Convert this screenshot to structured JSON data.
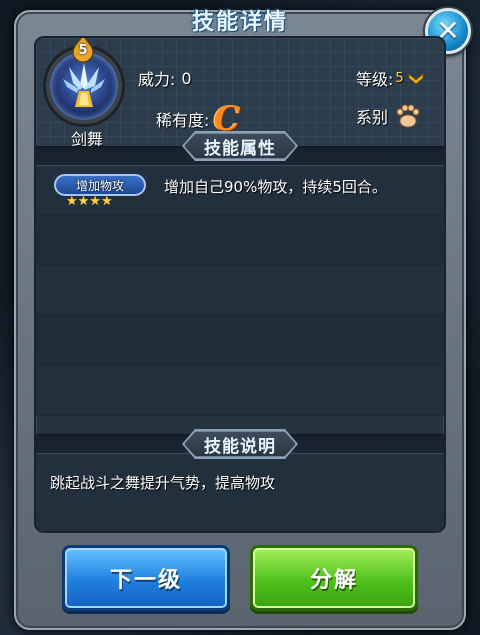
{
  "window": {
    "title": "技能详情",
    "close_symbol": "✕"
  },
  "skill": {
    "name": "剑舞",
    "level_badge": "5",
    "power_label": "威力:",
    "power_value": "0",
    "grade_label": "等级:",
    "grade_value": "5",
    "rarity_label": "稀有度:",
    "rarity_value": "C",
    "series_label": "系别",
    "series_icon": "paw-icon"
  },
  "sections": {
    "attributes_title": "技能属性",
    "description_title": "技能说明"
  },
  "attributes": [
    {
      "badge": "增加物攻",
      "stars": "★★★★",
      "star_count": 4,
      "desc": "增加自己90%物攻，持续5回合。"
    }
  ],
  "description": "跳起战斗之舞提升气势，提高物攻",
  "buttons": {
    "next_level": "下一级",
    "decompose": "分解"
  },
  "colors": {
    "accent_blue": "#1f7fe0",
    "accent_green": "#4fc21a",
    "rarity_orange": "#ff8a1e",
    "star_gold": "#ffd23c"
  }
}
